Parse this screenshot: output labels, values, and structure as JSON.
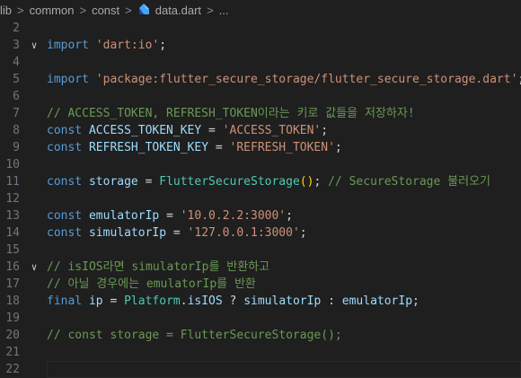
{
  "breadcrumb": {
    "segments": [
      "lib",
      "common",
      "const",
      "data.dart",
      "..."
    ],
    "separator": ">"
  },
  "editor": {
    "lines": [
      {
        "n": "2",
        "fold": false,
        "tokens": []
      },
      {
        "n": "3",
        "fold": true,
        "tokens": [
          [
            "k",
            "import"
          ],
          [
            "d",
            " "
          ],
          [
            "s",
            "'dart:io'"
          ],
          [
            "d",
            ";"
          ]
        ]
      },
      {
        "n": "4",
        "fold": false,
        "tokens": []
      },
      {
        "n": "5",
        "fold": false,
        "tokens": [
          [
            "k",
            "import"
          ],
          [
            "d",
            " "
          ],
          [
            "s",
            "'package:flutter_secure_storage/flutter_secure_storage.dart'"
          ],
          [
            "d",
            ";"
          ]
        ]
      },
      {
        "n": "6",
        "fold": false,
        "tokens": []
      },
      {
        "n": "7",
        "fold": false,
        "tokens": [
          [
            "c",
            "// ACCESS_TOKEN, REFRESH_TOKEN이라는 키로 값들을 저장하자!"
          ]
        ]
      },
      {
        "n": "8",
        "fold": false,
        "tokens": [
          [
            "k",
            "const"
          ],
          [
            "d",
            " "
          ],
          [
            "v",
            "ACCESS_TOKEN_KEY"
          ],
          [
            "d",
            " = "
          ],
          [
            "s",
            "'ACCESS_TOKEN'"
          ],
          [
            "d",
            ";"
          ]
        ]
      },
      {
        "n": "9",
        "fold": false,
        "tokens": [
          [
            "k",
            "const"
          ],
          [
            "d",
            " "
          ],
          [
            "v",
            "REFRESH_TOKEN_KEY"
          ],
          [
            "d",
            " = "
          ],
          [
            "s",
            "'REFRESH_TOKEN'"
          ],
          [
            "d",
            ";"
          ]
        ]
      },
      {
        "n": "10",
        "fold": false,
        "tokens": []
      },
      {
        "n": "11",
        "fold": false,
        "tokens": [
          [
            "k",
            "const"
          ],
          [
            "d",
            " "
          ],
          [
            "v",
            "storage"
          ],
          [
            "d",
            " = "
          ],
          [
            "t",
            "FlutterSecureStorage"
          ],
          [
            "p1",
            "()"
          ],
          [
            "d",
            "; "
          ],
          [
            "c",
            "// SecureStorage 불러오기"
          ]
        ]
      },
      {
        "n": "12",
        "fold": false,
        "tokens": []
      },
      {
        "n": "13",
        "fold": false,
        "tokens": [
          [
            "k",
            "const"
          ],
          [
            "d",
            " "
          ],
          [
            "v",
            "emulatorIp"
          ],
          [
            "d",
            " = "
          ],
          [
            "s",
            "'10.0.2.2:3000'"
          ],
          [
            "d",
            ";"
          ]
        ]
      },
      {
        "n": "14",
        "fold": false,
        "tokens": [
          [
            "k",
            "const"
          ],
          [
            "d",
            " "
          ],
          [
            "v",
            "simulatorIp"
          ],
          [
            "d",
            " = "
          ],
          [
            "s",
            "'127.0.0.1:3000'"
          ],
          [
            "d",
            ";"
          ]
        ]
      },
      {
        "n": "15",
        "fold": false,
        "tokens": []
      },
      {
        "n": "16",
        "fold": true,
        "tokens": [
          [
            "c",
            "// isIOS라면 simulatorIp를 반환하고"
          ]
        ]
      },
      {
        "n": "17",
        "fold": false,
        "tokens": [
          [
            "c",
            "// 아닐 경우에는 emulatorIp를 반환"
          ]
        ]
      },
      {
        "n": "18",
        "fold": false,
        "tokens": [
          [
            "k",
            "final"
          ],
          [
            "d",
            " "
          ],
          [
            "v",
            "ip"
          ],
          [
            "d",
            " = "
          ],
          [
            "t",
            "Platform"
          ],
          [
            "d",
            "."
          ],
          [
            "v",
            "isIOS"
          ],
          [
            "d",
            " ? "
          ],
          [
            "v",
            "simulatorIp"
          ],
          [
            "d",
            " : "
          ],
          [
            "v",
            "emulatorIp"
          ],
          [
            "d",
            ";"
          ]
        ]
      },
      {
        "n": "19",
        "fold": false,
        "tokens": []
      },
      {
        "n": "20",
        "fold": false,
        "tokens": [
          [
            "c",
            "// const storage = FlutterSecureStorage();"
          ]
        ]
      },
      {
        "n": "21",
        "fold": false,
        "tokens": []
      },
      {
        "n": "22",
        "fold": false,
        "tokens": [],
        "current": true
      }
    ]
  }
}
